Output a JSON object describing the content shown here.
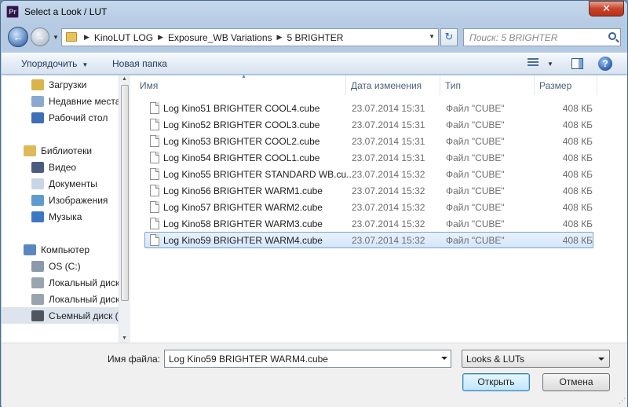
{
  "window": {
    "title": "Select a Look / LUT",
    "app_icon_text": "Pr",
    "close_glyph": "✕"
  },
  "nav": {
    "back_glyph": "←",
    "forward_glyph": "→",
    "breadcrumbs": [
      "KinoLUT LOG",
      "Exposure_WB Variations",
      "5 BRIGHTER"
    ],
    "search_placeholder": "Поиск: 5 BRIGHTER",
    "refresh_glyph": "↻"
  },
  "toolbar": {
    "organize_label": "Упорядочить",
    "new_folder_label": "Новая папка",
    "help_glyph": "?"
  },
  "sidebar": {
    "items": [
      {
        "label": "Загрузки",
        "icon": "downloads-folder-icon",
        "color": "#d9b44a"
      },
      {
        "label": "Недавние места",
        "icon": "recent-places-icon",
        "color": "#8aa9cf"
      },
      {
        "label": "Рабочий стол",
        "icon": "desktop-icon",
        "color": "#3d6fb4"
      },
      {
        "label": "Библиотеки",
        "icon": "libraries-icon",
        "color": "#e0b85a"
      },
      {
        "label": "Видео",
        "icon": "video-icon",
        "color": "#4a5d7c"
      },
      {
        "label": "Документы",
        "icon": "documents-icon",
        "color": "#c9d6e6"
      },
      {
        "label": "Изображения",
        "icon": "pictures-icon",
        "color": "#5e9bd1"
      },
      {
        "label": "Музыка",
        "icon": "music-icon",
        "color": "#3b78c4"
      },
      {
        "label": "Компьютер",
        "icon": "computer-icon",
        "color": "#5a87c0"
      },
      {
        "label": "OS (C:)",
        "icon": "system-drive-icon",
        "color": "#8b9aab"
      },
      {
        "label": "Локальный диск",
        "icon": "local-disk-icon",
        "color": "#9aa4ae"
      },
      {
        "label": "Локальный диск",
        "icon": "local-disk-icon",
        "color": "#9aa4ae"
      },
      {
        "label": "Съемный диск (",
        "icon": "removable-disk-icon",
        "color": "#4e5660"
      }
    ]
  },
  "columns": {
    "name": "Имя",
    "date": "Дата изменения",
    "type": "Тип",
    "size": "Размер"
  },
  "files": [
    {
      "name": "Log Kino51 BRIGHTER COOL4.cube",
      "date": "23.07.2014 15:31",
      "type": "Файл \"CUBE\"",
      "size": "408 КБ"
    },
    {
      "name": "Log Kino52 BRIGHTER COOL3.cube",
      "date": "23.07.2014 15:31",
      "type": "Файл \"CUBE\"",
      "size": "408 КБ"
    },
    {
      "name": "Log Kino53 BRIGHTER COOL2.cube",
      "date": "23.07.2014 15:31",
      "type": "Файл \"CUBE\"",
      "size": "408 КБ"
    },
    {
      "name": "Log Kino54 BRIGHTER COOL1.cube",
      "date": "23.07.2014 15:31",
      "type": "Файл \"CUBE\"",
      "size": "408 КБ"
    },
    {
      "name": "Log Kino55 BRIGHTER STANDARD WB.cu...",
      "date": "23.07.2014 15:32",
      "type": "Файл \"CUBE\"",
      "size": "408 КБ"
    },
    {
      "name": "Log Kino56 BRIGHTER WARM1.cube",
      "date": "23.07.2014 15:32",
      "type": "Файл \"CUBE\"",
      "size": "408 КБ"
    },
    {
      "name": "Log Kino57 BRIGHTER WARM2.cube",
      "date": "23.07.2014 15:32",
      "type": "Файл \"CUBE\"",
      "size": "408 КБ"
    },
    {
      "name": "Log Kino58 BRIGHTER WARM3.cube",
      "date": "23.07.2014 15:32",
      "type": "Файл \"CUBE\"",
      "size": "408 КБ"
    },
    {
      "name": "Log Kino59 BRIGHTER WARM4.cube",
      "date": "23.07.2014 15:32",
      "type": "Файл \"CUBE\"",
      "size": "408 КБ",
      "selected": true
    }
  ],
  "footer": {
    "filename_label": "Имя файла:",
    "filename_value": "Log Kino59 BRIGHTER WARM4.cube",
    "filetype_value": "Looks & LUTs",
    "open_label": "Открыть",
    "cancel_label": "Отмена"
  }
}
